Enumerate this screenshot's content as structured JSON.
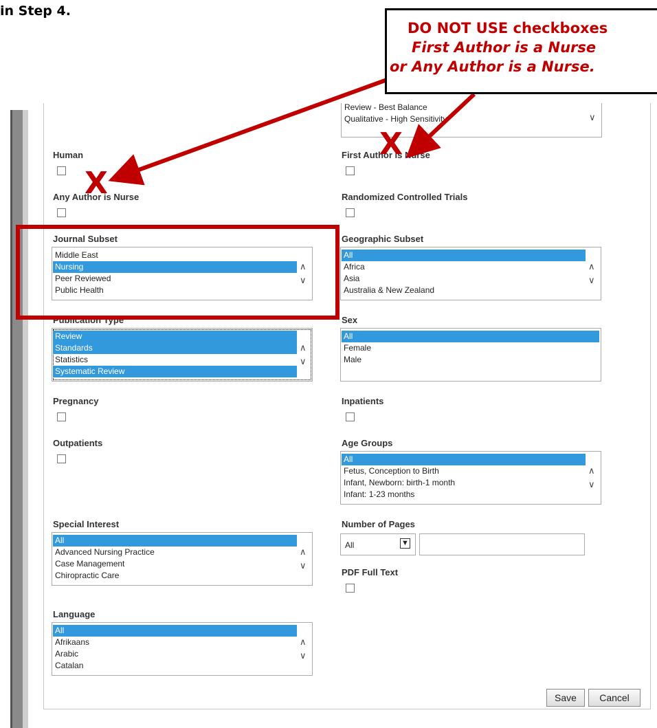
{
  "intro_text": "in Step 4.",
  "callout": {
    "line1": "DO NOT USE checkboxes",
    "line2": "First Author is a Nurse",
    "line3": "or Any Author is a Nurse."
  },
  "x_mark": "X",
  "colors": {
    "accent_red": "#c00000",
    "selection_blue": "#3399dd"
  },
  "form": {
    "top_list": {
      "options": [
        "Review - Best Balance",
        "Qualitative - High Sensitivity"
      ]
    },
    "human": {
      "label": "Human"
    },
    "first_author_nurse": {
      "label": "First Author is Nurse"
    },
    "any_author_nurse": {
      "label": "Any Author is Nurse"
    },
    "rct": {
      "label": "Randomized Controlled Trials"
    },
    "journal_subset": {
      "label": "Journal Subset",
      "options": [
        "Middle East",
        "Nursing",
        "Peer Reviewed",
        "Public Health"
      ],
      "selected": [
        "Nursing"
      ]
    },
    "geographic_subset": {
      "label": "Geographic Subset",
      "options": [
        "All",
        "Africa",
        "Asia",
        "Australia & New Zealand"
      ],
      "selected": [
        "All"
      ]
    },
    "publication_type": {
      "label": "Publication Type",
      "options": [
        "Review",
        "Standards",
        "Statistics",
        "Systematic Review"
      ],
      "selected": [
        "Review",
        "Standards",
        "Systematic Review"
      ]
    },
    "sex": {
      "label": "Sex",
      "options": [
        "All",
        "Female",
        "Male"
      ],
      "selected": [
        "All"
      ]
    },
    "pregnancy": {
      "label": "Pregnancy"
    },
    "inpatients": {
      "label": "Inpatients"
    },
    "outpatients": {
      "label": "Outpatients"
    },
    "age_groups": {
      "label": "Age Groups",
      "options": [
        "All",
        "Fetus, Conception to Birth",
        "Infant, Newborn: birth-1 month",
        "Infant: 1-23 months"
      ],
      "selected": [
        "All"
      ]
    },
    "special_interest": {
      "label": "Special Interest",
      "options": [
        "All",
        "Advanced Nursing Practice",
        "Case Management",
        "Chiropractic Care"
      ],
      "selected": [
        "All"
      ]
    },
    "number_of_pages": {
      "label": "Number of Pages",
      "select_value": "All",
      "text_value": ""
    },
    "pdf_full_text": {
      "label": "PDF Full Text"
    },
    "language": {
      "label": "Language",
      "options": [
        "All",
        "Afrikaans",
        "Arabic",
        "Catalan"
      ],
      "selected": [
        "All"
      ]
    },
    "save_label": "Save",
    "cancel_label": "Cancel"
  }
}
